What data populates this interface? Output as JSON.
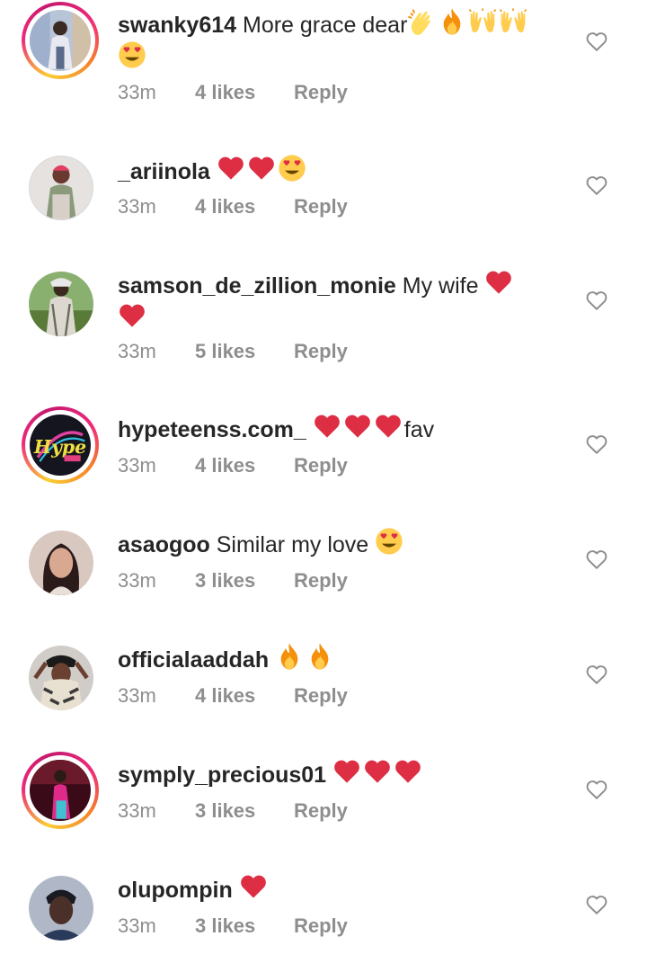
{
  "comments": [
    {
      "username": "swanky614",
      "text_before": " More grace dear",
      "emoji_line1": [
        "clapping-hands",
        "fire",
        "raising-hands",
        "raising-hands"
      ],
      "emoji_line2": [
        "heart-eyes"
      ],
      "time": "33m",
      "likes": "4 likes",
      "reply": "Reply",
      "has_story_ring": true,
      "avatar_color": "#7a6a9a"
    },
    {
      "username": "_ariinola",
      "text_before": " ",
      "emoji_line1": [
        "red-heart",
        "red-heart",
        "heart-eyes"
      ],
      "time": "33m",
      "likes": "4 likes",
      "reply": "Reply",
      "has_story_ring": false,
      "avatar_color": "#9a8a8a"
    },
    {
      "username": "samson_de_zillion_monie",
      "text_before": " My wife ",
      "emoji_line1": [
        "red-heart"
      ],
      "emoji_line2": [
        "red-heart"
      ],
      "time": "33m",
      "likes": "5 likes",
      "reply": "Reply",
      "has_story_ring": false,
      "avatar_color": "#6a8a5a"
    },
    {
      "username": "hypeteenss.com_",
      "text_before": " ",
      "emoji_line1": [
        "red-heart",
        "red-heart",
        "red-heart"
      ],
      "text_after": "fav",
      "time": "33m",
      "likes": "4 likes",
      "reply": "Reply",
      "has_story_ring": true,
      "avatar_color": "#1a1a2a",
      "avatar_text": "Hype"
    },
    {
      "username": "asaogoo",
      "text_before": " Similar my love ",
      "emoji_line1": [
        "heart-eyes"
      ],
      "time": "33m",
      "likes": "3 likes",
      "reply": "Reply",
      "has_story_ring": false,
      "avatar_color": "#c8a090"
    },
    {
      "username": "officialaaddah",
      "text_before": " ",
      "emoji_line1": [
        "fire",
        "fire"
      ],
      "time": "33m",
      "likes": "4 likes",
      "reply": "Reply",
      "has_story_ring": false,
      "avatar_color": "#8a7a6a"
    },
    {
      "username": "symply_precious01",
      "text_before": " ",
      "emoji_line1": [
        "red-heart",
        "red-heart",
        "red-heart"
      ],
      "time": "33m",
      "likes": "3 likes",
      "reply": "Reply",
      "has_story_ring": true,
      "avatar_color": "#5a1a2a"
    },
    {
      "username": "olupompin",
      "text_before": " ",
      "emoji_line1": [
        "red-heart"
      ],
      "time": "33m",
      "likes": "3 likes",
      "reply": "Reply",
      "has_story_ring": false,
      "avatar_color": "#3a4a6a"
    }
  ]
}
